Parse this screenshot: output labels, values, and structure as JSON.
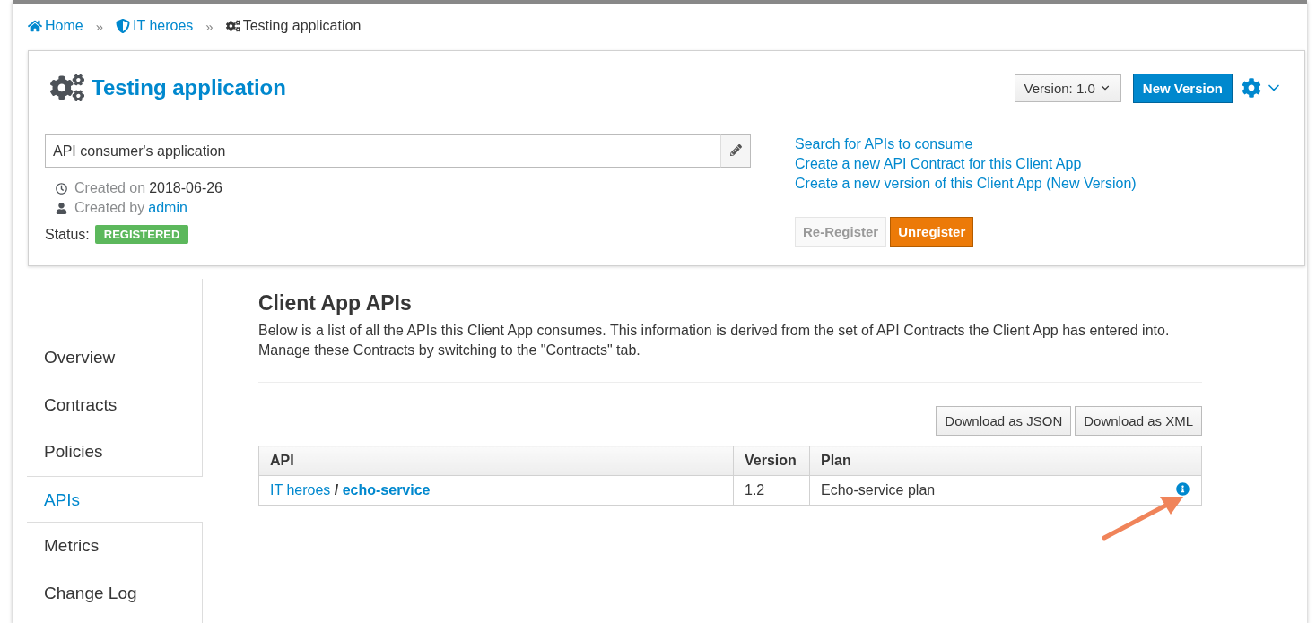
{
  "breadcrumb": [
    {
      "kind": "home",
      "label": "Home",
      "current": false
    },
    {
      "kind": "org",
      "separator": "»",
      "label": "IT heroes",
      "current": false
    },
    {
      "kind": "app",
      "separator": "»",
      "label": "Testing application",
      "current": true
    }
  ],
  "header": {
    "title": "Testing application",
    "version": "Version: 1.0",
    "new_version": "New Version",
    "description": "API consumer's application",
    "created_on_label": "Created on",
    "created_on": "2018-06-26",
    "created_by_label": "Created by",
    "created_by": "admin",
    "status_label": "Status:",
    "status": "REGISTERED",
    "links": [
      "Search for APIs to consume",
      "Create a new API Contract for this Client App",
      "Create a new version of this Client App (New Version)"
    ],
    "actions": [
      {
        "kind": "default",
        "label": "Re-Register",
        "disabled": true
      },
      {
        "kind": "warning",
        "label": "Unregister",
        "disabled": false
      }
    ]
  },
  "sidebar": {
    "items": [
      {
        "label": "Overview",
        "selected": false
      },
      {
        "label": "Contracts",
        "selected": false
      },
      {
        "label": "Policies",
        "selected": false
      },
      {
        "label": "APIs",
        "selected": true
      },
      {
        "label": "Metrics",
        "selected": false
      },
      {
        "label": "Change Log",
        "selected": false
      }
    ]
  },
  "content": {
    "title": "Client App APIs",
    "intro": "Below is a list of all the APIs this Client App consumes. This information is derived from the set of API Contracts the Client App has entered into. Manage these Contracts by switching to the \"Contracts\" tab.",
    "downloads": [
      "Download as JSON",
      "Download as XML"
    ],
    "table": {
      "columns": [
        "API",
        "Version",
        "Plan"
      ],
      "rows": [
        {
          "org": "IT heroes",
          "separator": "/",
          "api": "echo-service",
          "version": "1.2",
          "plan": "Echo-service plan"
        }
      ]
    }
  }
}
